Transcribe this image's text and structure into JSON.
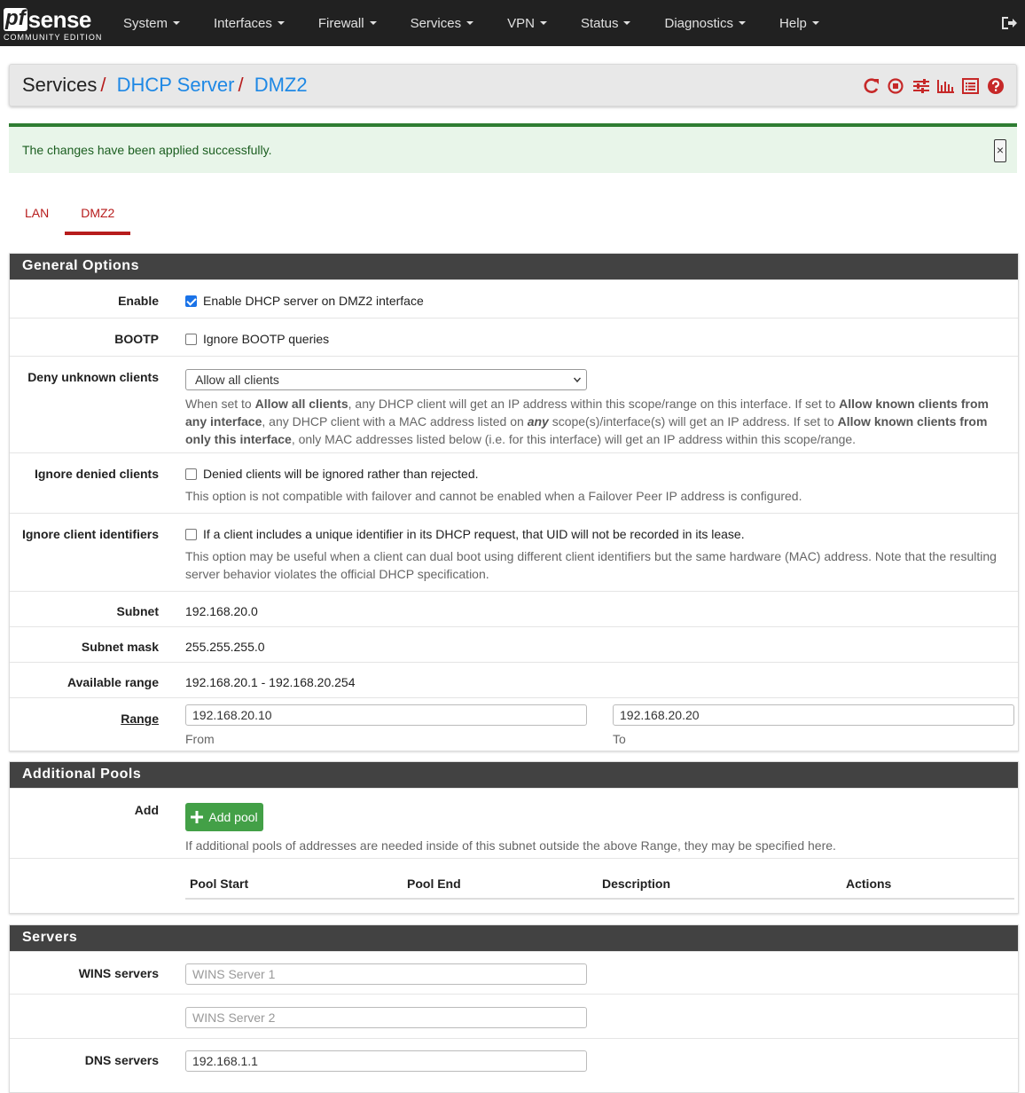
{
  "nav": {
    "logo_main": "pfsense",
    "logo_pf": "pf",
    "logo_sense": "sense",
    "logo_sub": "COMMUNITY EDITION",
    "menu": [
      "System",
      "Interfaces",
      "Firewall",
      "Services",
      "VPN",
      "Status",
      "Diagnostics",
      "Help"
    ],
    "logout_icon": "logout-icon"
  },
  "breadcrumb": {
    "root": "Services",
    "sep": "/",
    "level1": "DHCP Server",
    "level2": "DMZ2"
  },
  "header_icons": [
    "restart-icon",
    "stop-icon",
    "sliders-icon",
    "chart-icon",
    "log-icon",
    "help-icon"
  ],
  "accent_color": "#b71c1c",
  "alert": {
    "message": "The changes have been applied successfully.",
    "close": "×"
  },
  "tabs": [
    {
      "label": "LAN",
      "active": false
    },
    {
      "label": "DMZ2",
      "active": true
    }
  ],
  "general": {
    "heading": "General Options",
    "enable": {
      "label": "Enable",
      "text": "Enable DHCP server on DMZ2 interface",
      "checked": true
    },
    "bootp": {
      "label": "BOOTP",
      "text": "Ignore BOOTP queries",
      "checked": false
    },
    "deny": {
      "label": "Deny unknown clients",
      "selected": "Allow all clients",
      "help": {
        "p1": "When set to ",
        "b1": "Allow all clients",
        "p2": ", any DHCP client will get an IP address within this scope/range on this interface. If set to ",
        "b2": "Allow known clients from any interface",
        "p3": ", any DHCP client with a MAC address listed on ",
        "b3": "any",
        "p4": " scope(s)/interface(s) will get an IP address. If set to ",
        "b4": "Allow known clients from only this interface",
        "p5": ", only MAC addresses listed below (i.e. for this interface) will get an IP address within this scope/range."
      }
    },
    "ignore_denied": {
      "label": "Ignore denied clients",
      "text": "Denied clients will be ignored rather than rejected.",
      "help": "This option is not compatible with failover and cannot be enabled when a Failover Peer IP address is configured.",
      "checked": false
    },
    "ignore_ids": {
      "label": "Ignore client identifiers",
      "text": "If a client includes a unique identifier in its DHCP request, that UID will not be recorded in its lease.",
      "help": "This option may be useful when a client can dual boot using different client identifiers but the same hardware (MAC) address. Note that the resulting server behavior violates the official DHCP specification.",
      "checked": false
    },
    "subnet": {
      "label": "Subnet",
      "value": "192.168.20.0"
    },
    "mask": {
      "label": "Subnet mask",
      "value": "255.255.255.0"
    },
    "avail": {
      "label": "Available range",
      "value": "192.168.20.1 - 192.168.20.254"
    },
    "range": {
      "label": "Range",
      "from": "192.168.20.10",
      "to": "192.168.20.20",
      "from_help": "From",
      "to_help": "To"
    }
  },
  "pools": {
    "heading": "Additional Pools",
    "add_label": "Add",
    "add_button": "Add pool",
    "help": "If additional pools of addresses are needed inside of this subnet outside the above Range, they may be specified here.",
    "columns": [
      "Pool Start",
      "Pool End",
      "Description",
      "Actions"
    ]
  },
  "servers": {
    "heading": "Servers",
    "wins_label": "WINS servers",
    "wins1_placeholder": "WINS Server 1",
    "wins2_placeholder": "WINS Server 2",
    "dns_label": "DNS servers",
    "dns1": "192.168.1.1"
  }
}
